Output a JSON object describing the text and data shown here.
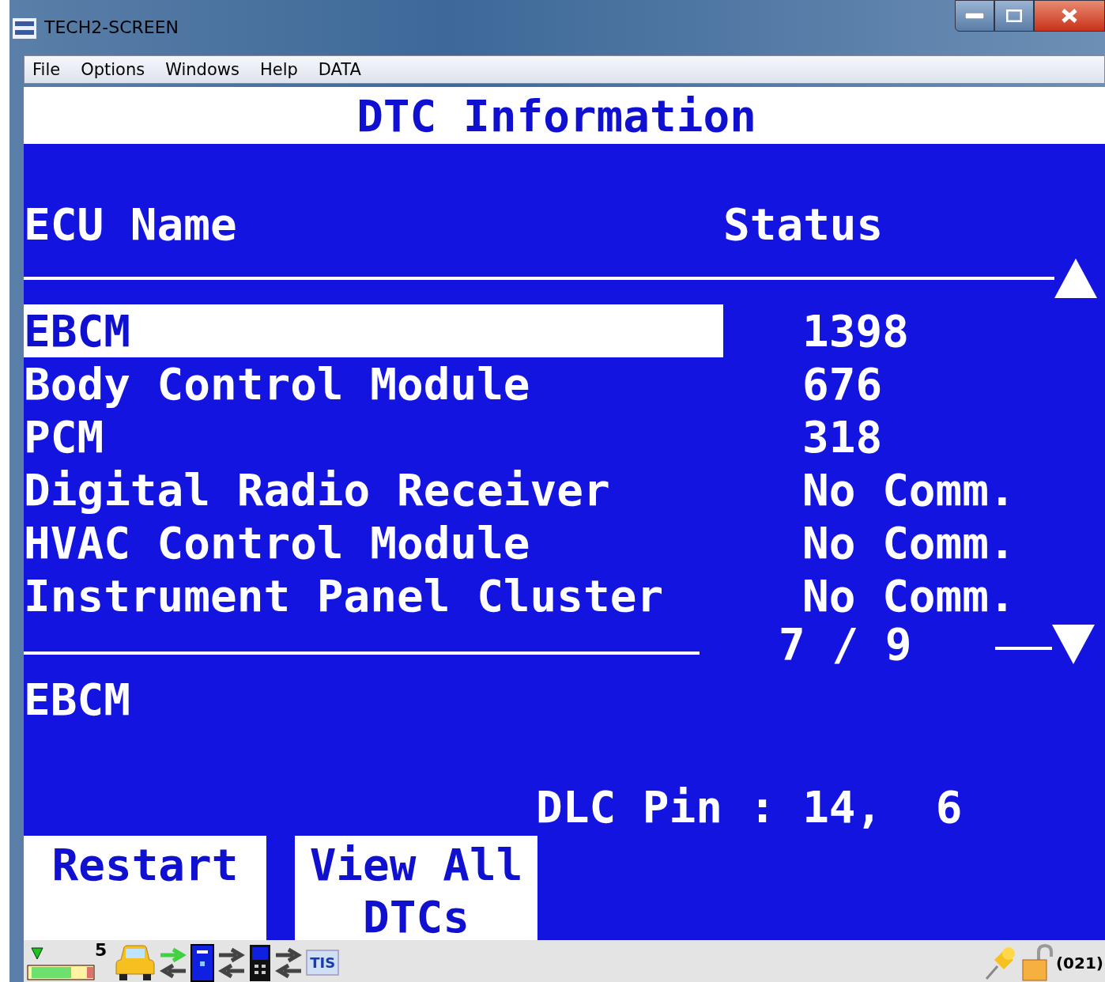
{
  "window": {
    "title": "TECH2-SCREEN"
  },
  "menu": [
    "File",
    "Options",
    "Windows",
    "Help",
    "DATA"
  ],
  "screen": {
    "title": "DTC Information",
    "columns": [
      "ECU Name",
      "Status"
    ],
    "rows": [
      {
        "name": "EBCM",
        "status": "1398",
        "selected": true
      },
      {
        "name": "Body Control Module",
        "status": "676",
        "selected": false
      },
      {
        "name": "PCM",
        "status": "318",
        "selected": false
      },
      {
        "name": "Digital Radio Receiver",
        "status": "No Comm.",
        "selected": false
      },
      {
        "name": "HVAC Control Module",
        "status": "No Comm.",
        "selected": false
      },
      {
        "name": "Instrument Panel Cluster",
        "status": "No Comm.",
        "selected": false
      }
    ],
    "page": "7 / 9",
    "selected_label": "EBCM",
    "dlc": "DLC Pin : 14,  6"
  },
  "buttons": [
    "Restart",
    "View All DTCs"
  ],
  "status_bar": {
    "count": "5",
    "tis": "TIS",
    "code": "(021)"
  }
}
